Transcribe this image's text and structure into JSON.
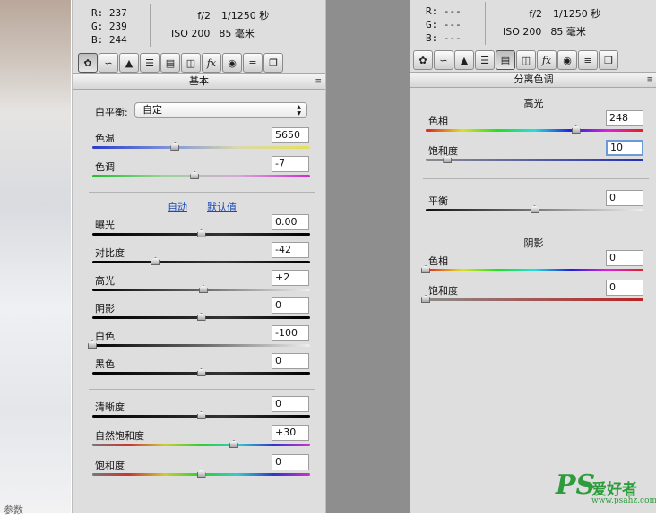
{
  "photo": {
    "caption": "参数"
  },
  "left_panel": {
    "readout": {
      "r": "R:  237",
      "g": "G:  239",
      "b": "B:  244"
    },
    "meta": {
      "aperture": "f/2",
      "shutter": "1/1250 秒",
      "iso": "ISO 200",
      "focal": "85 毫米"
    },
    "toolbar_icons": [
      "aperture-icon",
      "tone-curve-icon",
      "detail-icon",
      "hsl-icon",
      "split-toning-icon",
      "lens-icon",
      "fx-icon",
      "camera-calibration-icon",
      "presets-icon",
      "snapshots-icon"
    ],
    "section_title": "基本",
    "white_balance": {
      "label": "白平衡:",
      "value": "自定"
    },
    "sliders_top": [
      {
        "id": "temp",
        "label": "色温",
        "value": "5650",
        "level": 0.38,
        "track": "temperature"
      },
      {
        "id": "tint",
        "label": "色调",
        "value": "-7",
        "level": 0.47,
        "track": "tint"
      }
    ],
    "auto_label": "自动",
    "default_label": "默认值",
    "sliders_tone": [
      {
        "id": "exposure",
        "label": "曝光",
        "value": "0.00",
        "level": 0.5,
        "track": "dark"
      },
      {
        "id": "contrast",
        "label": "对比度",
        "value": "-42",
        "level": 0.29,
        "track": "dark"
      },
      {
        "id": "highlights",
        "label": "高光",
        "value": "+2",
        "level": 0.51,
        "track": "light"
      },
      {
        "id": "shadows",
        "label": "阴影",
        "value": "0",
        "level": 0.5,
        "track": "dark"
      },
      {
        "id": "whites",
        "label": "白色",
        "value": "-100",
        "level": 0.0,
        "track": "light"
      },
      {
        "id": "blacks",
        "label": "黑色",
        "value": "0",
        "level": 0.5,
        "track": "dark"
      }
    ],
    "sliders_presence": [
      {
        "id": "clarity",
        "label": "清晰度",
        "value": "0",
        "level": 0.5,
        "track": "dark"
      },
      {
        "id": "vibrance",
        "label": "自然饱和度",
        "value": "+30",
        "level": 0.65,
        "track": "sat"
      },
      {
        "id": "saturation",
        "label": "饱和度",
        "value": "0",
        "level": 0.5,
        "track": "sat"
      }
    ]
  },
  "right_panel": {
    "readout": {
      "r": "R:  ---",
      "g": "G:  ---",
      "b": "B:  ---"
    },
    "meta": {
      "aperture": "f/2",
      "shutter": "1/1250 秒",
      "iso": "ISO 200",
      "focal": "85 毫米"
    },
    "section_title": "分离色调",
    "highlights_title": "高光",
    "highlights": [
      {
        "id": "hl-hue",
        "label": "色相",
        "value": "248",
        "level": 0.69,
        "track": "hue"
      },
      {
        "id": "hl-sat",
        "label": "饱和度",
        "value": "10",
        "level": 0.1,
        "track": "blue-sat",
        "focus": true
      }
    ],
    "balance": {
      "label": "平衡",
      "value": "0",
      "level": 0.5
    },
    "shadows_title": "阴影",
    "shadows": [
      {
        "id": "sh-hue",
        "label": "色相",
        "value": "0",
        "level": 0.0,
        "track": "hue"
      },
      {
        "id": "sh-sat",
        "label": "饱和度",
        "value": "0",
        "level": 0.0,
        "track": "red-sat"
      }
    ]
  },
  "watermark": {
    "ps": "PS",
    "cn": "爱好者",
    "url": "www.psahz.com"
  }
}
